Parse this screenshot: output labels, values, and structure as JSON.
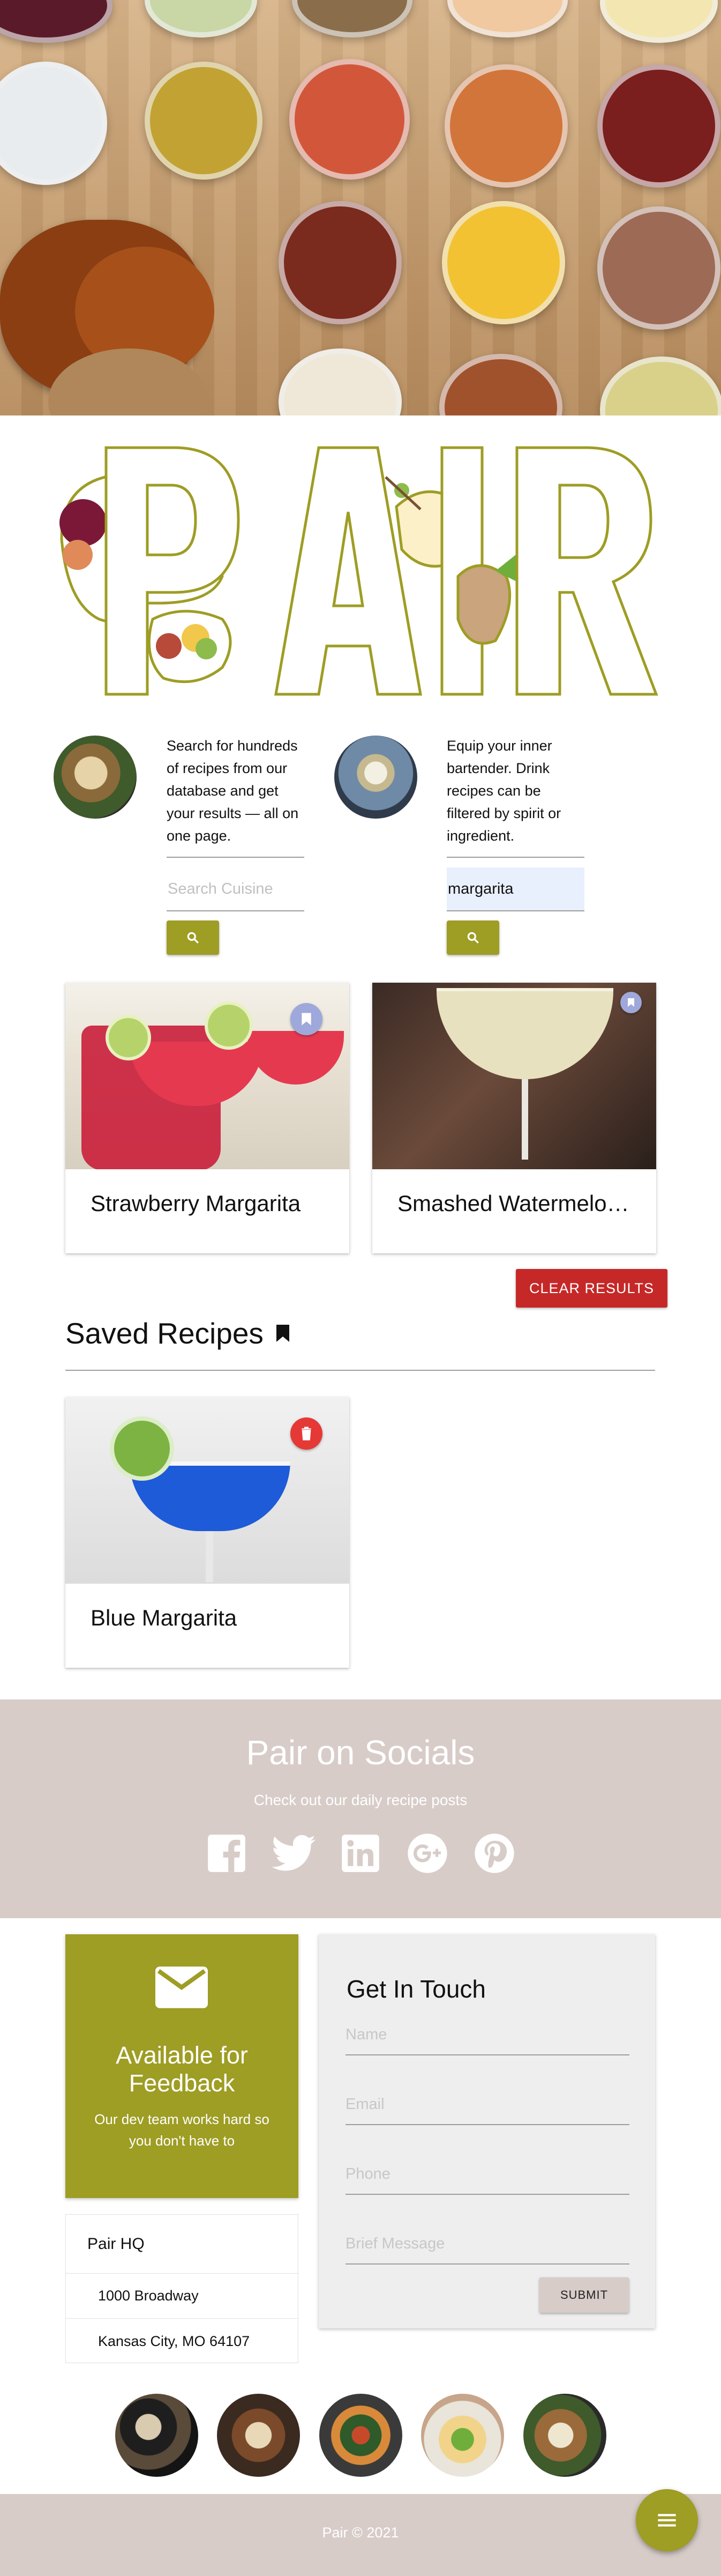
{
  "brand": {
    "name": "PAIR",
    "accent": "#9e9d24",
    "danger": "#c62828",
    "neutral": "#d7ccc8"
  },
  "search": {
    "cuisine": {
      "description": "Search for hundreds of recipes from our database and get your results — all on one page.",
      "placeholder": "Search Cuisine",
      "value": ""
    },
    "drink": {
      "description": "Equip your inner bartender. Drink recipes can be filtered by spirit or ingredient.",
      "placeholder": "",
      "value": "margarita"
    }
  },
  "results": [
    {
      "title": "Strawberry Margarita",
      "icon": "bookmark-icon"
    },
    {
      "title": "Smashed Watermelon Margarita",
      "icon": "bookmark-icon"
    }
  ],
  "clear_results_label": "CLEAR RESULTS",
  "saved": {
    "heading": "Saved Recipes",
    "items": [
      {
        "title": "Blue Margarita",
        "icon": "trash-icon"
      }
    ]
  },
  "socials": {
    "heading": "Pair on Socials",
    "subheading": "Check out our daily recipe posts",
    "icons": [
      "facebook-icon",
      "twitter-icon",
      "linkedin-icon",
      "google-plus-icon",
      "pinterest-icon"
    ]
  },
  "feedback": {
    "heading": "Available for Feedback",
    "text": "Our dev team works hard so you don't have to"
  },
  "hq": {
    "name": "Pair HQ",
    "street": "1000 Broadway",
    "city": "Kansas City, MO 64107"
  },
  "contact": {
    "heading": "Get In Touch",
    "name_placeholder": "Name",
    "email_placeholder": "Email",
    "phone_placeholder": "Phone",
    "message_placeholder": "Brief Message",
    "submit_label": "SUBMIT"
  },
  "footer": {
    "copyright": "Pair © 2021"
  }
}
